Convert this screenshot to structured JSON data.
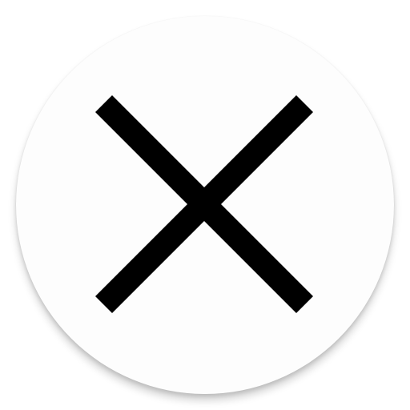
{
  "close_button": {
    "icon": "close-icon",
    "background_color": "#fdfdfd",
    "icon_color": "#000000"
  }
}
